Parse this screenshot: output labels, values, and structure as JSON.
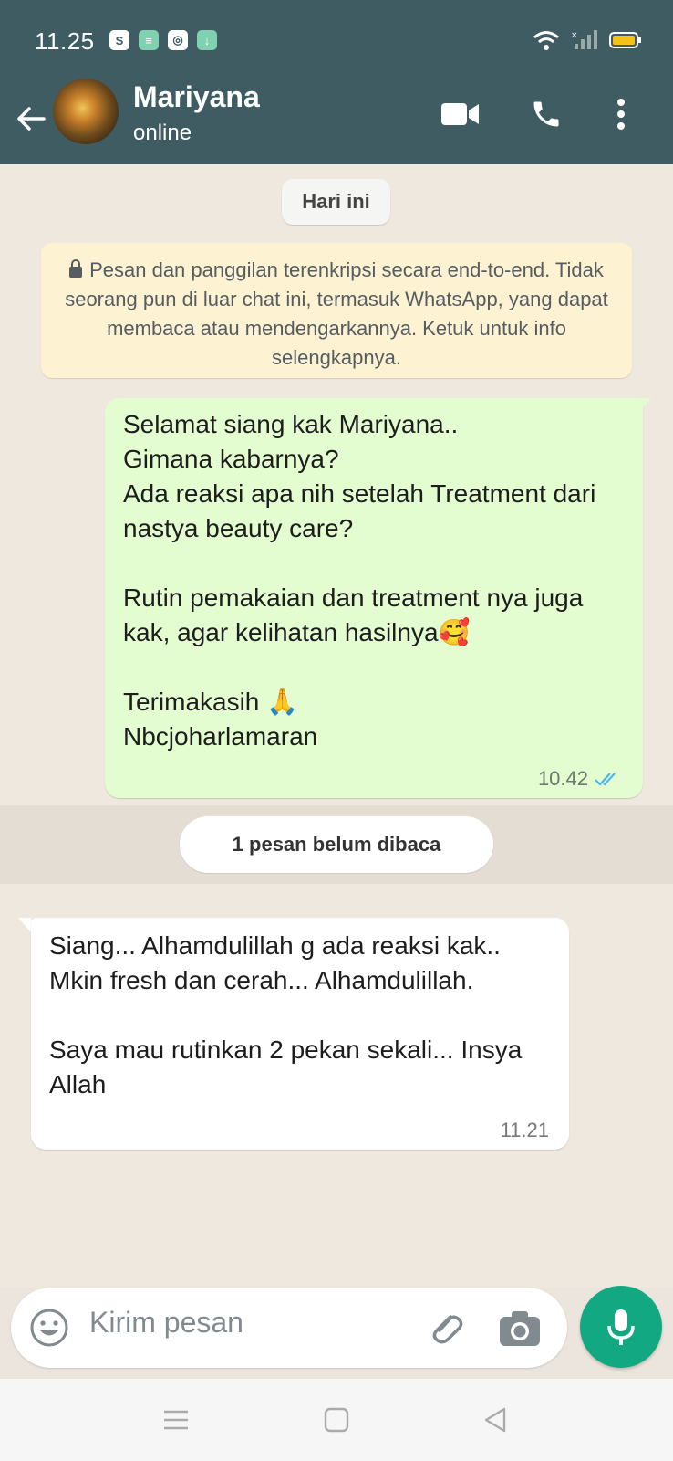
{
  "status_bar": {
    "time": "11.25"
  },
  "header": {
    "contact_name": "Mariyana",
    "status": "online"
  },
  "chat": {
    "date_chip": "Hari ini",
    "encryption_notice": "Pesan dan panggilan terenkripsi secara end-to-end. Tidak seorang pun di luar chat ini, termasuk WhatsApp, yang dapat membaca atau mendengarkannya. Ketuk untuk info selengkapnya.",
    "messages": [
      {
        "direction": "outgoing",
        "text": "Selamat siang kak Mariyana..\nGimana kabarnya?\nAda reaksi apa nih setelah Treatment dari nastya beauty care?\n\nRutin pemakaian dan treatment nya juga kak, agar kelihatan hasilnya🥰\n\nTerimakasih 🙏\nNbcjoharlamaran",
        "time": "10.42",
        "status": "read"
      },
      {
        "direction": "incoming",
        "text": "Siang... Alhamdulillah g ada reaksi kak.. Mkin fresh dan cerah... Alhamdulillah.\n\nSaya mau rutinkan 2 pekan sekali... Insya Allah",
        "time": "11.21"
      }
    ],
    "unread_label": "1 pesan belum dibaca"
  },
  "composer": {
    "placeholder": "Kirim pesan"
  },
  "colors": {
    "header": "#3f5c63",
    "outgoing_bubble": "#e3fdd1",
    "mic_button": "#12a982",
    "read_ticks": "#4fb6ec"
  }
}
